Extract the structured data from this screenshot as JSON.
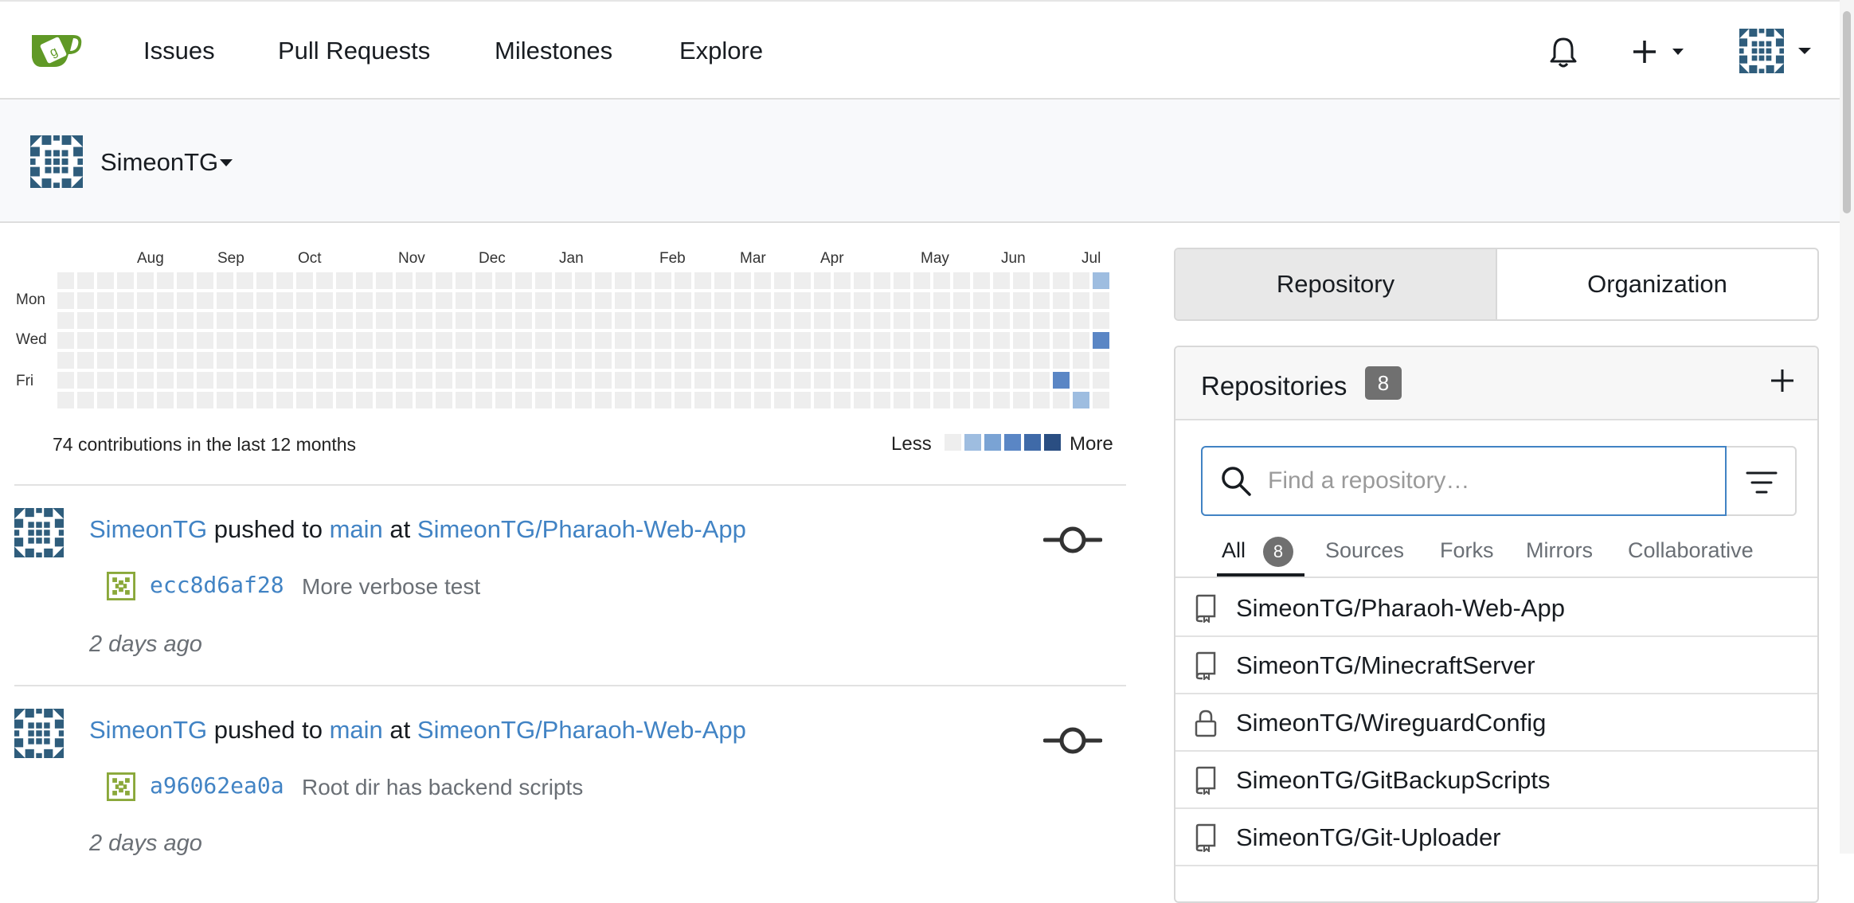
{
  "nav": {
    "items": [
      "Issues",
      "Pull Requests",
      "Milestones",
      "Explore"
    ]
  },
  "context": {
    "user": "SimeonTG"
  },
  "heatmap": {
    "months": [
      "Aug",
      "Sep",
      "Oct",
      "Nov",
      "Dec",
      "Jan",
      "Feb",
      "Mar",
      "Apr",
      "May",
      "Jun",
      "Jul"
    ],
    "days": [
      "Mon",
      "Wed",
      "Fri"
    ],
    "summary": "74 contributions in the last 12 months",
    "less": "Less",
    "more": "More",
    "active": [
      {
        "week": 52,
        "day": 0,
        "level": 1
      },
      {
        "week": 52,
        "day": 3,
        "level": 3
      },
      {
        "week": 50,
        "day": 5,
        "level": 3
      },
      {
        "week": 51,
        "day": 6,
        "level": 1
      }
    ],
    "colors": [
      "#eeeeee",
      "#9ebde0",
      "#7aa3d4",
      "#5a86c5",
      "#3f6aa8",
      "#2a4e82"
    ]
  },
  "feed": [
    {
      "user": "SimeonTG",
      "action": "pushed to",
      "branch": "main",
      "at": "at",
      "repo": "SimeonTG/Pharaoh-Web-App",
      "sha": "ecc8d6af28",
      "message": "More verbose test",
      "time": "2 days ago"
    },
    {
      "user": "SimeonTG",
      "action": "pushed to",
      "branch": "main",
      "at": "at",
      "repo": "SimeonTG/Pharaoh-Web-App",
      "sha": "a96062ea0a",
      "message": "Root dir has backend scripts",
      "time": "2 days ago"
    }
  ],
  "switcher": {
    "repository": "Repository",
    "organization": "Organization"
  },
  "repos": {
    "title": "Repositories",
    "count": "8",
    "search_placeholder": "Find a repository…",
    "tabs": {
      "all": "All",
      "all_count": "8",
      "sources": "Sources",
      "forks": "Forks",
      "mirrors": "Mirrors",
      "collaborative": "Collaborative"
    },
    "list": [
      {
        "name": "SimeonTG/Pharaoh-Web-App",
        "icon": "repo-icon"
      },
      {
        "name": "SimeonTG/MinecraftServer",
        "icon": "repo-icon"
      },
      {
        "name": "SimeonTG/WireguardConfig",
        "icon": "lock-icon"
      },
      {
        "name": "SimeonTG/GitBackupScripts",
        "icon": "repo-icon"
      },
      {
        "name": "SimeonTG/Git-Uploader",
        "icon": "repo-icon"
      }
    ]
  }
}
